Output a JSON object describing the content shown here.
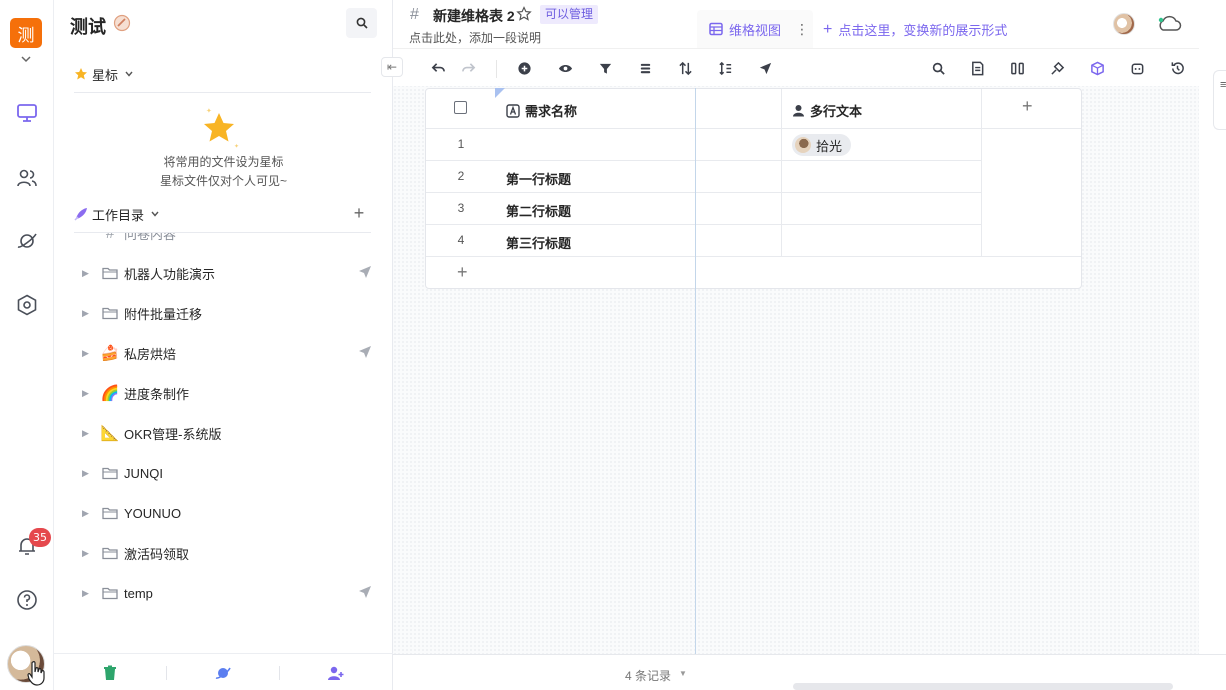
{
  "space": {
    "logo_char": "测",
    "name": "测试"
  },
  "nav": {
    "notification_count": "35"
  },
  "sidebar": {
    "starred_label": "星标",
    "starred_tip_line1": "将常用的文件设为星标",
    "starred_tip_line2": "星标文件仅对个人可见~",
    "catalog_label": "工作目录",
    "partial_item": "问卷内容",
    "items": [
      {
        "label": "机器人功能演示",
        "icon": "folder-icon",
        "shared": true
      },
      {
        "label": "附件批量迁移",
        "icon": "folder-icon",
        "shared": false
      },
      {
        "label": "私房烘焙",
        "icon": "cake-emoji",
        "shared": true
      },
      {
        "label": "进度条制作",
        "icon": "rainbow-emoji",
        "shared": false
      },
      {
        "label": "OKR管理-系统版",
        "icon": "triangle-ruler-emoji",
        "shared": false
      },
      {
        "label": "JUNQI",
        "icon": "folder-icon",
        "shared": false
      },
      {
        "label": "YOUNUO",
        "icon": "folder-icon",
        "shared": false
      },
      {
        "label": "激活码领取",
        "icon": "folder-icon",
        "shared": false
      },
      {
        "label": "temp",
        "icon": "folder-icon",
        "shared": true
      }
    ]
  },
  "doc": {
    "title": "新建维格表 2",
    "permission": "可以管理",
    "description": "点击此处，添加一段说明"
  },
  "views": {
    "active": "维格视图",
    "add_hint": "点击这里，变换新的展示形式"
  },
  "grid": {
    "columns": [
      {
        "name": "需求名称",
        "type": "text"
      },
      {
        "name": "",
        "type": "text"
      },
      {
        "name": "多行文本",
        "type": "member"
      }
    ],
    "rows": [
      {
        "num": "1",
        "title": "",
        "member": "拾光"
      },
      {
        "num": "2",
        "title": "第一行标题",
        "member": ""
      },
      {
        "num": "3",
        "title": "第二行标题",
        "member": ""
      },
      {
        "num": "4",
        "title": "第三行标题",
        "member": ""
      }
    ],
    "add_row": "+",
    "add_col": "+"
  },
  "footer": {
    "records": "4 条记录"
  },
  "colors": {
    "accent": "#7b67ee",
    "logo": "#f5700a",
    "badge": "#e5484d"
  }
}
